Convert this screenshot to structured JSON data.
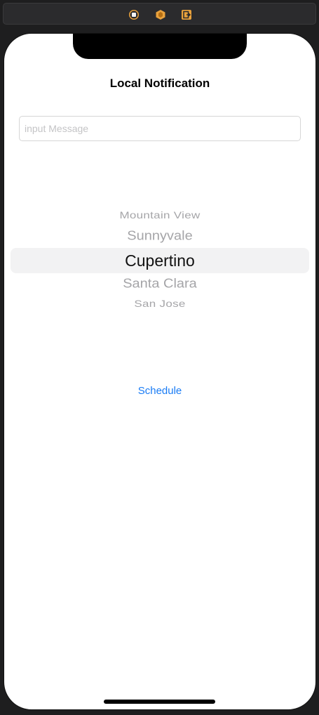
{
  "toolbar": {
    "icons": [
      "stop-square-icon",
      "cube-icon",
      "exit-icon"
    ],
    "accent": "#e8a13c"
  },
  "screen": {
    "title": "Local Notification",
    "message_field": {
      "placeholder": "input Message",
      "value": ""
    },
    "picker": {
      "items": [
        "Mountain View",
        "Sunnyvale",
        "Cupertino",
        "Santa Clara",
        "San Jose"
      ],
      "selected": "Cupertino"
    },
    "schedule_label": "Schedule"
  },
  "colors": {
    "button_text": "#1a7cf5",
    "picker_selected_text": "#111111",
    "picker_faded_text": "#a5a5a8"
  }
}
